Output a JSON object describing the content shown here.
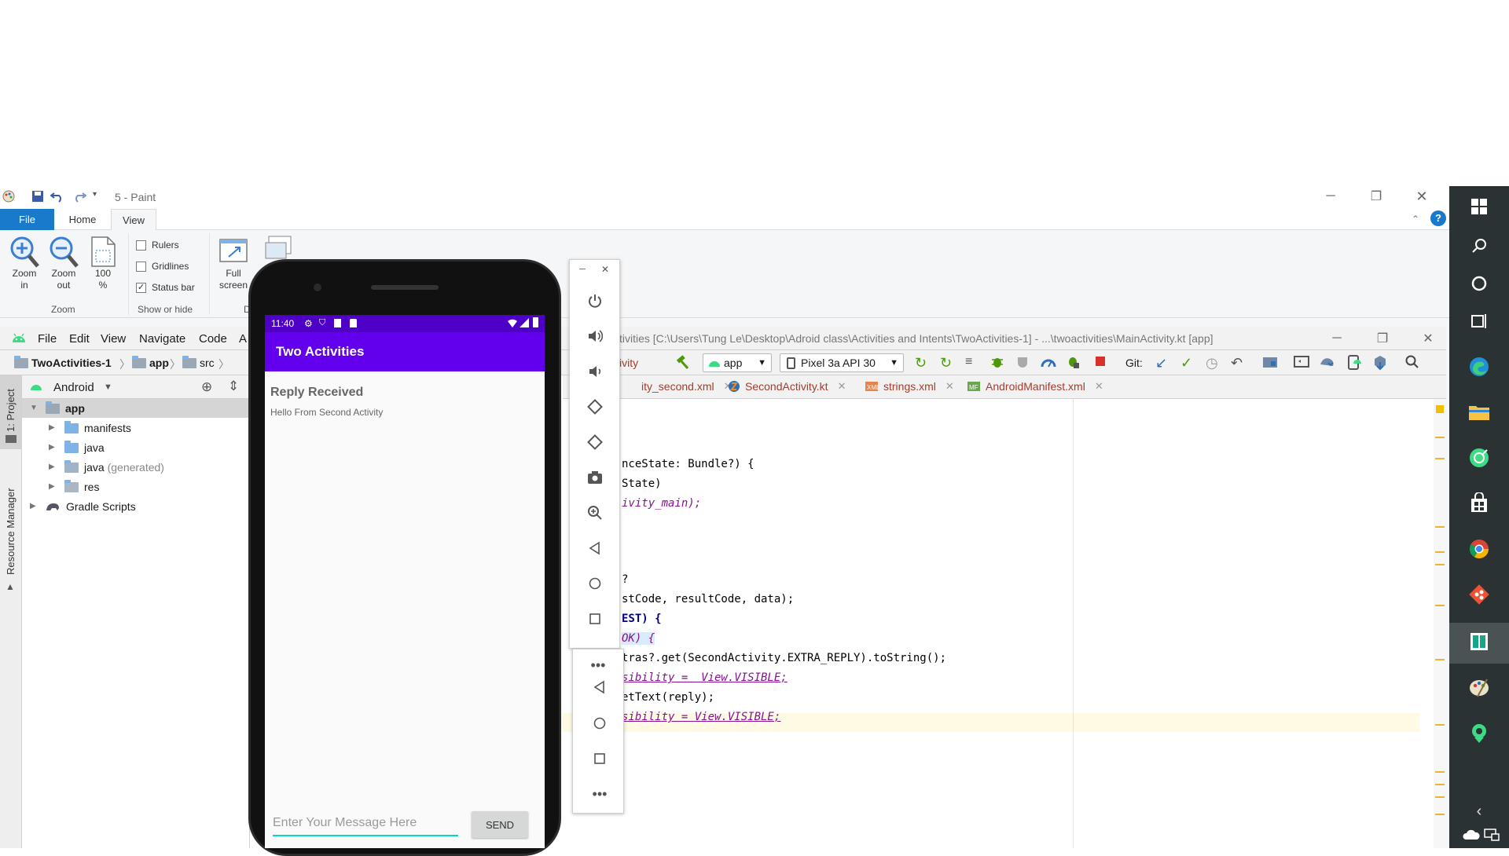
{
  "paint": {
    "title": "5 - Paint",
    "tabs": [
      "File",
      "Home",
      "View"
    ],
    "zoom_in": [
      "Zoom",
      "in"
    ],
    "zoom_out": [
      "Zoom",
      "out"
    ],
    "hundred": [
      "100",
      "%"
    ],
    "zoom_group": "Zoom",
    "rulers": "Rulers",
    "gridlines": "Gridlines",
    "status_bar": "Status bar",
    "show_hide_group": "Show or hide",
    "full_screen": [
      "Full",
      "screen"
    ],
    "display_group": "D"
  },
  "studio": {
    "menu": [
      "File",
      "Edit",
      "View",
      "Navigate",
      "Code",
      "A"
    ],
    "title": "tivities [C:\\Users\\Tung Le\\Desktop\\Adroid class\\Activities and Intents\\TwoActivities-1] - ...\\twoactivities\\MainActivity.kt [app]",
    "breadcrumbs": [
      "TwoActivities-1",
      "app",
      "src"
    ],
    "toolbar_partial": "ivity",
    "module": "app",
    "device": "Pixel 3a API 30",
    "git_label": "Git:",
    "side_tabs": [
      "1: Project",
      "Resource Manager"
    ],
    "project_view": "Android",
    "tree": [
      {
        "label": "app",
        "level": 0
      },
      {
        "label": "manifests",
        "level": 1
      },
      {
        "label": "java",
        "level": 1
      },
      {
        "label": "java",
        "suffix": "(generated)",
        "level": 1
      },
      {
        "label": "res",
        "level": 1
      },
      {
        "label": "Gradle Scripts",
        "level": 0
      }
    ],
    "editor_tabs": [
      "ity_second.xml",
      "SecondActivity.kt",
      "strings.xml",
      "AndroidManifest.xml"
    ],
    "code_lines": [
      "nceState: Bundle?) {",
      "State)",
      "ivity_main);",
      "?",
      "stCode, resultCode, data);",
      "EST) {",
      "OK) {",
      "tras?.get(SecondActivity.EXTRA_REPLY).toString();",
      "sibility =  View.VISIBLE;",
      "etText(reply);",
      "sibility = View.VISIBLE;"
    ]
  },
  "emulator": {
    "time": "11:40",
    "app_title": "Two Activities",
    "reply_heading": "Reply Received",
    "reply_text": "Hello From Second Activity",
    "input_placeholder": "Enter Your Message Here",
    "send_label": "SEND"
  },
  "colors": {
    "app_bar": "#6200ee",
    "status_bar": "#4f00c7",
    "paint_file_tab": "#1979ca",
    "input_underline": "#03dac5"
  }
}
